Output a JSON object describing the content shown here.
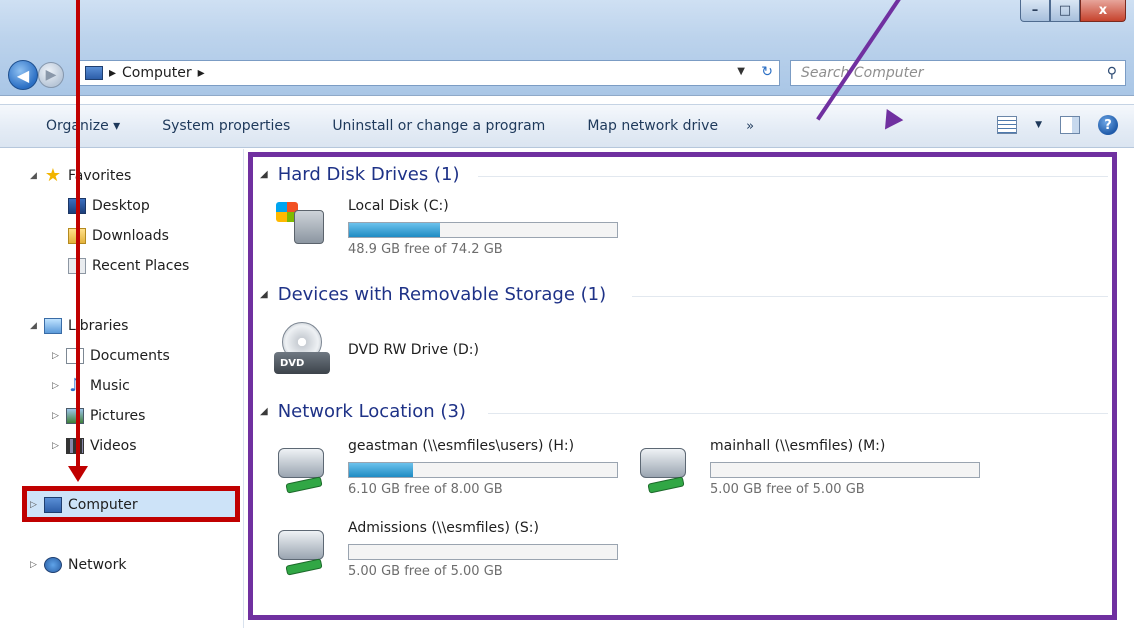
{
  "window": {
    "controls": {
      "minimize": "–",
      "maximize": "□",
      "close": "x"
    }
  },
  "nav": {
    "back_icon": "back-arrow-icon",
    "forward_icon": "forward-arrow-icon",
    "address_crumbs": [
      "▸",
      "Computer",
      "▸"
    ],
    "search_placeholder": "Search Computer",
    "search_icon": "search-icon"
  },
  "toolbar": {
    "organize": "Organize ▾",
    "system_properties": "System properties",
    "uninstall": "Uninstall or change a program",
    "map_drive": "Map network drive",
    "more": "»"
  },
  "sidebar": {
    "favorites": "Favorites",
    "favorites_items": [
      "Desktop",
      "Downloads",
      "Recent Places"
    ],
    "libraries": "Libraries",
    "library_items": [
      "Documents",
      "Music",
      "Pictures",
      "Videos"
    ],
    "computer": "Computer",
    "network": "Network"
  },
  "content": {
    "groups": [
      {
        "title": "Hard Disk Drives (1)"
      },
      {
        "title": "Devices with Removable Storage (1)"
      },
      {
        "title": "Network Location (3)"
      }
    ],
    "drives": [
      {
        "name": "Local Disk (C:)",
        "free": "48.9 GB free of 74.2 GB",
        "used_fraction": 0.34
      },
      {
        "name": "DVD RW Drive (D:)",
        "label": "DVD"
      },
      {
        "name": "geastman (\\\\esmfiles\\users) (H:)",
        "free": "6.10 GB free of 8.00 GB",
        "used_fraction": 0.24
      },
      {
        "name": "mainhall (\\\\esmfiles) (M:)",
        "free": "5.00 GB free of 5.00 GB",
        "used_fraction": 0.0
      },
      {
        "name": "Admissions (\\\\esmfiles) (S:)",
        "free": "5.00 GB free of 5.00 GB",
        "used_fraction": 0.0
      }
    ]
  },
  "colors": {
    "annotation_red": "#c00000",
    "annotation_purple": "#7030a0",
    "group_header": "#1e3287",
    "bar_fill": "#1e8bc3"
  }
}
